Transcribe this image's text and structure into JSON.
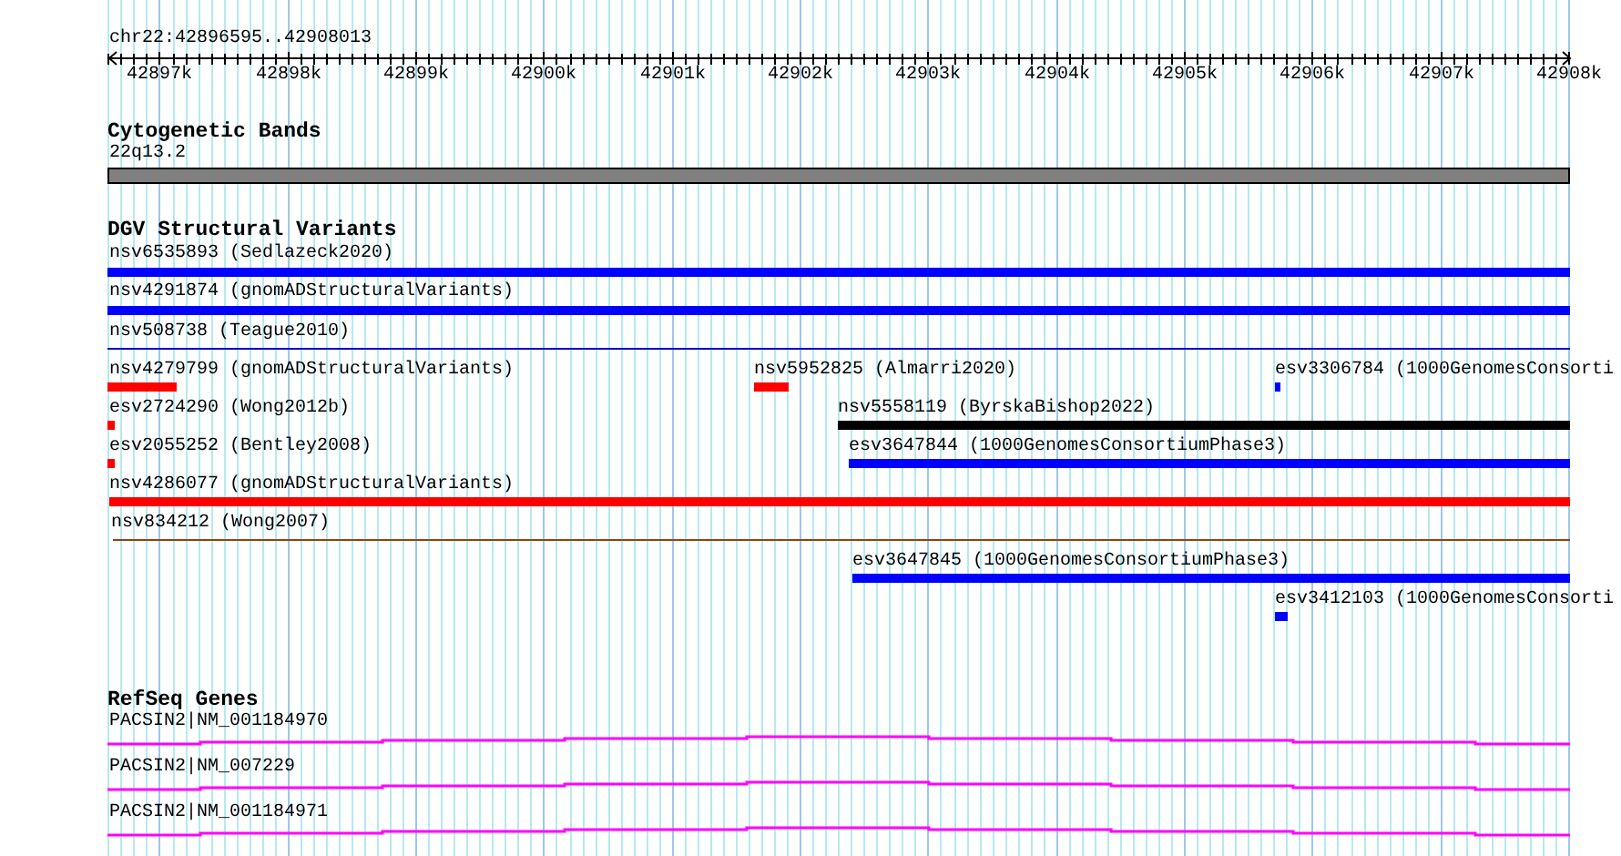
{
  "ruler": {
    "title": "chr22:42896595..42908013",
    "labels": [
      "42897k",
      "42898k",
      "42899k",
      "42900k",
      "42901k",
      "42902k",
      "42903k",
      "42904k",
      "42905k",
      "42906k",
      "42907k",
      "42908k"
    ]
  },
  "tracks": [
    {
      "kind": "bands",
      "title": "Cytogenetic Bands",
      "features": [
        {
          "label": "22q13.2"
        }
      ]
    },
    {
      "kind": "variants",
      "title": "DGV Structural Variants",
      "features": [
        {
          "label": "nsv6535893 (Sedlazeck2020)",
          "kind": "bar",
          "color": "#0000ff"
        },
        {
          "label": "nsv4291874 (gnomADStructuralVariants)",
          "kind": "bar",
          "color": "#0000ff"
        },
        {
          "label": "nsv508738 (Teague2010)",
          "kind": "line",
          "color": "#0000cc"
        },
        {
          "label": "nsv4279799 (gnomADStructuralVariants)",
          "kind": "bar",
          "color": "#ff0000"
        },
        {
          "label": "nsv5952825 (Almarri2020)",
          "kind": "bar",
          "color": "#ff0000"
        },
        {
          "label": "esv3306784 (1000GenomesConsorti",
          "kind": "bar",
          "color": "#0000ff"
        },
        {
          "label": "esv2724290 (Wong2012b)",
          "kind": "bar",
          "color": "#ff0000"
        },
        {
          "label": "nsv5558119 (ByrskaBishop2022)",
          "kind": "bar",
          "color": "#000000"
        },
        {
          "label": "esv2055252 (Bentley2008)",
          "kind": "bar",
          "color": "#ff0000"
        },
        {
          "label": "esv3647844 (1000GenomesConsortiumPhase3)",
          "kind": "bar",
          "color": "#0000ff"
        },
        {
          "label": "nsv4286077 (gnomADStructuralVariants)",
          "kind": "bar",
          "color": "#ff0000"
        },
        {
          "label": "nsv834212 (Wong2007)",
          "kind": "line",
          "color": "#8b4513"
        },
        {
          "label": "esv3647845 (1000GenomesConsortiumPhase3)",
          "kind": "bar",
          "color": "#0000ff"
        },
        {
          "label": "esv3412103 (1000GenomesConsorti",
          "kind": "bar",
          "color": "#0000ff"
        }
      ]
    },
    {
      "kind": "genes",
      "title": "RefSeq Genes",
      "features": [
        {
          "label": "PACSIN2|NM_001184970"
        },
        {
          "label": "PACSIN2|NM_007229"
        },
        {
          "label": "PACSIN2|NM_001184971"
        }
      ]
    }
  ]
}
